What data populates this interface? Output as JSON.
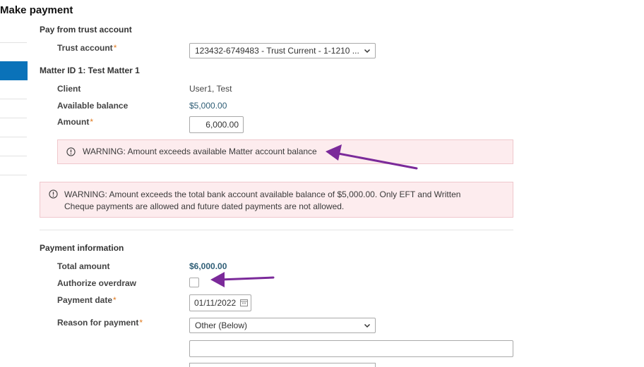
{
  "page": {
    "title": "Make payment"
  },
  "trust": {
    "section_title": "Pay from trust account",
    "account_label": "Trust account",
    "account_value": "123432-6749483 - Trust Current - 1-1210 ..."
  },
  "matter": {
    "title": "Matter ID 1: Test Matter 1",
    "client_label": "Client",
    "client_value": "User1, Test",
    "balance_label": "Available balance",
    "balance_value": "$5,000.00",
    "amount_label": "Amount",
    "amount_value": "6,000.00"
  },
  "warnings": {
    "matter_warning": "WARNING: Amount exceeds available Matter account balance",
    "bank_warning": "WARNING: Amount exceeds the total bank account available balance of $5,000.00. Only EFT and Written Cheque payments are allowed and future dated payments are not allowed."
  },
  "payment": {
    "section_title": "Payment information",
    "total_label": "Total amount",
    "total_value": "$6,000.00",
    "overdraw_label": "Authorize overdraw",
    "overdraw_checked": false,
    "date_label": "Payment date",
    "date_value": "01/11/2022",
    "reason_label": "Reason for payment",
    "reason_value": "Other (Below)",
    "reason_other_value": ""
  },
  "required_marker": "*",
  "colors": {
    "accent": "#0a72b9",
    "warning_bg": "#fdecee",
    "annotation_arrow": "#7b2a9a"
  }
}
